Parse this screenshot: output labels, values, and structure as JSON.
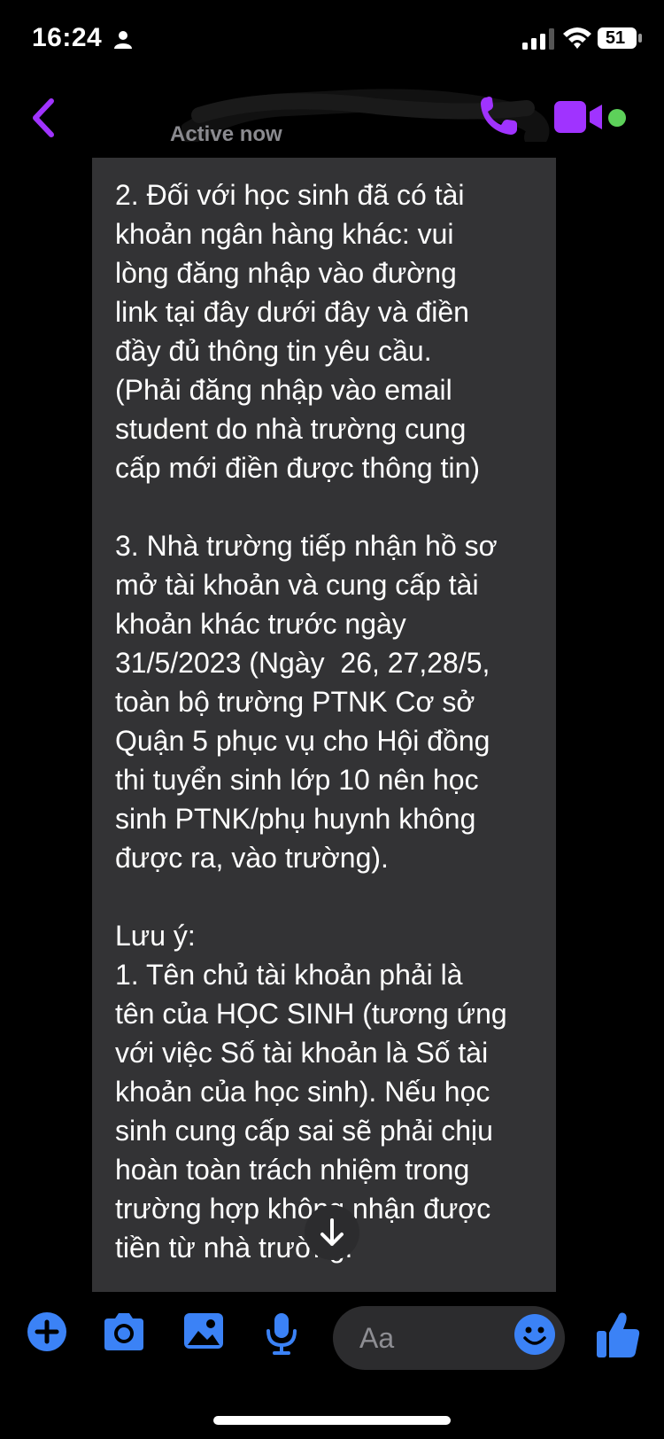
{
  "status_bar": {
    "time": "16:24",
    "battery": "51"
  },
  "header": {
    "contact_name": "",
    "active_status": "Active now"
  },
  "message": {
    "paragraphs": [
      "2. Đối với học sinh đã có tài\nkhoản ngân hàng khác: vui\nlòng đăng nhập vào đường\nlink tại đây dưới đây và điền\nđầy đủ thông tin yêu cầu.\n(Phải đăng nhập vào email\nstudent do nhà trường cung\ncấp mới điền được thông tin)",
      "3. Nhà trường tiếp nhận hồ sơ\nmở tài khoản và cung cấp tài\nkhoản khác trước ngày\n31/5/2023 (Ngày  26, 27,28/5,\ntoàn bộ trường PTNK Cơ sở\nQuận 5 phục vụ cho Hội đồng\nthi tuyển sinh lớp 10 nên học\nsinh PTNK/phụ huynh không\nđược ra, vào trường).",
      "Lưu ý:\n1. Tên chủ tài khoản phải là\ntên của HỌC SINH (tương ứng\nvới việc Số tài khoản là Số tài\nkhoản của học sinh). Nếu học\nsinh cung cấp sai sẽ phải chịu\nhoàn toàn trách nhiệm trong\ntrường hợp không nhận được\ntiền từ nhà trường."
    ]
  },
  "composer": {
    "placeholder": "Aa"
  },
  "colors": {
    "accent_purple": "#a033ff",
    "accent_blue": "#3b82f6",
    "bubble": "#333335",
    "online": "#5dd15a"
  },
  "icons": [
    "person-icon",
    "signal-icon",
    "wifi-icon",
    "battery-icon",
    "back-chevron-icon",
    "phone-icon",
    "video-camera-icon",
    "arrow-down-icon",
    "plus-icon",
    "camera-icon",
    "gallery-icon",
    "microphone-icon",
    "emoji-icon",
    "thumbs-up-icon"
  ]
}
